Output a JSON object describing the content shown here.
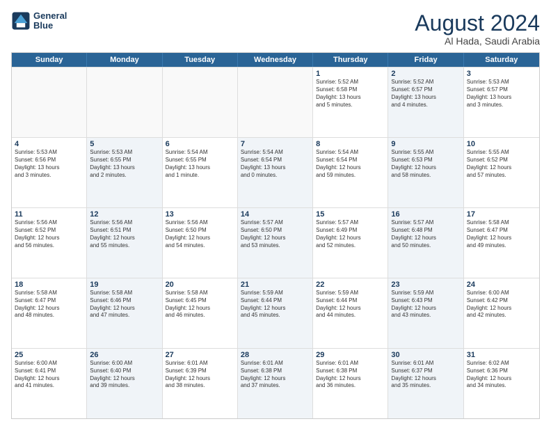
{
  "logo": {
    "line1": "General",
    "line2": "Blue"
  },
  "title": "August 2024",
  "location": "Al Hada, Saudi Arabia",
  "header_days": [
    "Sunday",
    "Monday",
    "Tuesday",
    "Wednesday",
    "Thursday",
    "Friday",
    "Saturday"
  ],
  "rows": [
    [
      {
        "day": "",
        "text": "",
        "empty": true
      },
      {
        "day": "",
        "text": "",
        "empty": true
      },
      {
        "day": "",
        "text": "",
        "empty": true
      },
      {
        "day": "",
        "text": "",
        "empty": true
      },
      {
        "day": "1",
        "text": "Sunrise: 5:52 AM\nSunset: 6:58 PM\nDaylight: 13 hours\nand 5 minutes.",
        "empty": false,
        "shaded": false
      },
      {
        "day": "2",
        "text": "Sunrise: 5:52 AM\nSunset: 6:57 PM\nDaylight: 13 hours\nand 4 minutes.",
        "empty": false,
        "shaded": true
      },
      {
        "day": "3",
        "text": "Sunrise: 5:53 AM\nSunset: 6:57 PM\nDaylight: 13 hours\nand 3 minutes.",
        "empty": false,
        "shaded": false
      }
    ],
    [
      {
        "day": "4",
        "text": "Sunrise: 5:53 AM\nSunset: 6:56 PM\nDaylight: 13 hours\nand 3 minutes.",
        "empty": false,
        "shaded": false
      },
      {
        "day": "5",
        "text": "Sunrise: 5:53 AM\nSunset: 6:55 PM\nDaylight: 13 hours\nand 2 minutes.",
        "empty": false,
        "shaded": true
      },
      {
        "day": "6",
        "text": "Sunrise: 5:54 AM\nSunset: 6:55 PM\nDaylight: 13 hours\nand 1 minute.",
        "empty": false,
        "shaded": false
      },
      {
        "day": "7",
        "text": "Sunrise: 5:54 AM\nSunset: 6:54 PM\nDaylight: 13 hours\nand 0 minutes.",
        "empty": false,
        "shaded": true
      },
      {
        "day": "8",
        "text": "Sunrise: 5:54 AM\nSunset: 6:54 PM\nDaylight: 12 hours\nand 59 minutes.",
        "empty": false,
        "shaded": false
      },
      {
        "day": "9",
        "text": "Sunrise: 5:55 AM\nSunset: 6:53 PM\nDaylight: 12 hours\nand 58 minutes.",
        "empty": false,
        "shaded": true
      },
      {
        "day": "10",
        "text": "Sunrise: 5:55 AM\nSunset: 6:52 PM\nDaylight: 12 hours\nand 57 minutes.",
        "empty": false,
        "shaded": false
      }
    ],
    [
      {
        "day": "11",
        "text": "Sunrise: 5:56 AM\nSunset: 6:52 PM\nDaylight: 12 hours\nand 56 minutes.",
        "empty": false,
        "shaded": false
      },
      {
        "day": "12",
        "text": "Sunrise: 5:56 AM\nSunset: 6:51 PM\nDaylight: 12 hours\nand 55 minutes.",
        "empty": false,
        "shaded": true
      },
      {
        "day": "13",
        "text": "Sunrise: 5:56 AM\nSunset: 6:50 PM\nDaylight: 12 hours\nand 54 minutes.",
        "empty": false,
        "shaded": false
      },
      {
        "day": "14",
        "text": "Sunrise: 5:57 AM\nSunset: 6:50 PM\nDaylight: 12 hours\nand 53 minutes.",
        "empty": false,
        "shaded": true
      },
      {
        "day": "15",
        "text": "Sunrise: 5:57 AM\nSunset: 6:49 PM\nDaylight: 12 hours\nand 52 minutes.",
        "empty": false,
        "shaded": false
      },
      {
        "day": "16",
        "text": "Sunrise: 5:57 AM\nSunset: 6:48 PM\nDaylight: 12 hours\nand 50 minutes.",
        "empty": false,
        "shaded": true
      },
      {
        "day": "17",
        "text": "Sunrise: 5:58 AM\nSunset: 6:47 PM\nDaylight: 12 hours\nand 49 minutes.",
        "empty": false,
        "shaded": false
      }
    ],
    [
      {
        "day": "18",
        "text": "Sunrise: 5:58 AM\nSunset: 6:47 PM\nDaylight: 12 hours\nand 48 minutes.",
        "empty": false,
        "shaded": false
      },
      {
        "day": "19",
        "text": "Sunrise: 5:58 AM\nSunset: 6:46 PM\nDaylight: 12 hours\nand 47 minutes.",
        "empty": false,
        "shaded": true
      },
      {
        "day": "20",
        "text": "Sunrise: 5:58 AM\nSunset: 6:45 PM\nDaylight: 12 hours\nand 46 minutes.",
        "empty": false,
        "shaded": false
      },
      {
        "day": "21",
        "text": "Sunrise: 5:59 AM\nSunset: 6:44 PM\nDaylight: 12 hours\nand 45 minutes.",
        "empty": false,
        "shaded": true
      },
      {
        "day": "22",
        "text": "Sunrise: 5:59 AM\nSunset: 6:44 PM\nDaylight: 12 hours\nand 44 minutes.",
        "empty": false,
        "shaded": false
      },
      {
        "day": "23",
        "text": "Sunrise: 5:59 AM\nSunset: 6:43 PM\nDaylight: 12 hours\nand 43 minutes.",
        "empty": false,
        "shaded": true
      },
      {
        "day": "24",
        "text": "Sunrise: 6:00 AM\nSunset: 6:42 PM\nDaylight: 12 hours\nand 42 minutes.",
        "empty": false,
        "shaded": false
      }
    ],
    [
      {
        "day": "25",
        "text": "Sunrise: 6:00 AM\nSunset: 6:41 PM\nDaylight: 12 hours\nand 41 minutes.",
        "empty": false,
        "shaded": false
      },
      {
        "day": "26",
        "text": "Sunrise: 6:00 AM\nSunset: 6:40 PM\nDaylight: 12 hours\nand 39 minutes.",
        "empty": false,
        "shaded": true
      },
      {
        "day": "27",
        "text": "Sunrise: 6:01 AM\nSunset: 6:39 PM\nDaylight: 12 hours\nand 38 minutes.",
        "empty": false,
        "shaded": false
      },
      {
        "day": "28",
        "text": "Sunrise: 6:01 AM\nSunset: 6:38 PM\nDaylight: 12 hours\nand 37 minutes.",
        "empty": false,
        "shaded": true
      },
      {
        "day": "29",
        "text": "Sunrise: 6:01 AM\nSunset: 6:38 PM\nDaylight: 12 hours\nand 36 minutes.",
        "empty": false,
        "shaded": false
      },
      {
        "day": "30",
        "text": "Sunrise: 6:01 AM\nSunset: 6:37 PM\nDaylight: 12 hours\nand 35 minutes.",
        "empty": false,
        "shaded": true
      },
      {
        "day": "31",
        "text": "Sunrise: 6:02 AM\nSunset: 6:36 PM\nDaylight: 12 hours\nand 34 minutes.",
        "empty": false,
        "shaded": false
      }
    ]
  ]
}
